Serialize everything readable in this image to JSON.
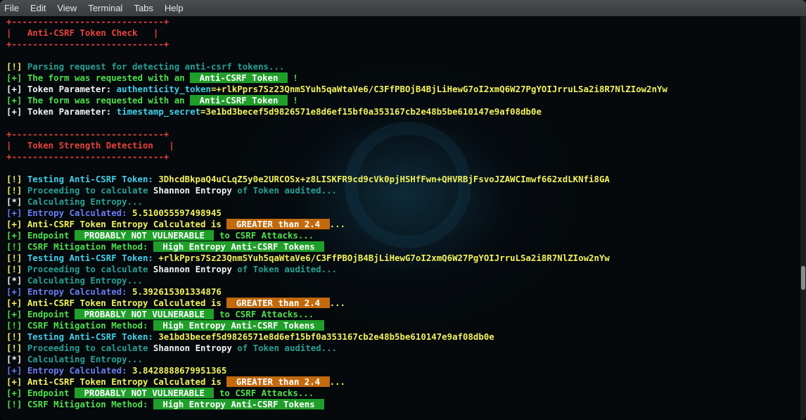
{
  "menu": [
    "File",
    "Edit",
    "View",
    "Terminal",
    "Tabs",
    "Help"
  ],
  "terminal": {
    "lines": [
      [
        {
          "t": "+-----------------------------+",
          "c": "c-red"
        }
      ],
      [
        {
          "t": "|   Anti-CSRF Token Check   |",
          "c": "c-red"
        }
      ],
      [
        {
          "t": "+-----------------------------+",
          "c": "c-red"
        }
      ],
      [],
      [
        {
          "t": "[!] ",
          "c": "c-yellow"
        },
        {
          "t": "Parsing request for detecting anti-csrf tokens...",
          "c": "c-dteal"
        }
      ],
      [
        {
          "t": "[+] ",
          "c": "c-green"
        },
        {
          "t": "The form was requested with an ",
          "c": "c-green"
        },
        {
          "t": " Anti-CSRF Token ",
          "c": "badge-green"
        },
        {
          "t": " !",
          "c": "c-green"
        }
      ],
      [
        {
          "t": "[+] ",
          "c": "c-white"
        },
        {
          "t": "Token Parameter: ",
          "c": "c-white"
        },
        {
          "t": "authenticity_token",
          "c": "c-cyan"
        },
        {
          "t": "=+rlkPprs7Sz23QnmSYuh5qaWtaVe6/C3FfPBOjB4BjLiHewG7oI2xmQ6W27PgYOIJrruLSa2i8R7NlZIow2nYw",
          "c": "c-yellow"
        }
      ],
      [
        {
          "t": "[+] ",
          "c": "c-green"
        },
        {
          "t": "The form was requested with an ",
          "c": "c-green"
        },
        {
          "t": " Anti-CSRF Token ",
          "c": "badge-green"
        },
        {
          "t": " !",
          "c": "c-green"
        }
      ],
      [
        {
          "t": "[+] ",
          "c": "c-white"
        },
        {
          "t": "Token Parameter: ",
          "c": "c-white"
        },
        {
          "t": "timestamp_secret",
          "c": "c-cyan"
        },
        {
          "t": "=3e1bd3becef5d9826571e8d6ef15bf0a353167cb2e48b5be610147e9af08db0e",
          "c": "c-yellow"
        }
      ],
      [],
      [
        {
          "t": "+-----------------------------+",
          "c": "c-red"
        }
      ],
      [
        {
          "t": "|   Token Strength Detection   |",
          "c": "c-red"
        }
      ],
      [
        {
          "t": "+-----------------------------+",
          "c": "c-red"
        }
      ],
      [],
      [
        {
          "t": "[!] ",
          "c": "c-yellow"
        },
        {
          "t": "Testing Anti-CSRF Token: ",
          "c": "c-cyan"
        },
        {
          "t": "3DhcdBkpaQ4uCLqZ5y0e2URCOSx+z8LISKFR9cd9cVk0pjHSHfFwn+QHVRBjFsvoJZAWCImwf662xdLKNfi8GA",
          "c": "c-yellow"
        }
      ],
      [
        {
          "t": "[!] ",
          "c": "c-yellow"
        },
        {
          "t": "Proceeding to calculate ",
          "c": "c-dteal"
        },
        {
          "t": "Shannon Entropy",
          "c": "c-white"
        },
        {
          "t": " of Token audited...",
          "c": "c-dteal"
        }
      ],
      [
        {
          "t": "[*] ",
          "c": "c-white"
        },
        {
          "t": "Calculating Entropy...",
          "c": "c-dteal"
        }
      ],
      [
        {
          "t": "[+] ",
          "c": "c-blue"
        },
        {
          "t": "Entropy Calculated: ",
          "c": "c-blue"
        },
        {
          "t": "5.510055597498945",
          "c": "c-yellow"
        }
      ],
      [
        {
          "t": "[+] ",
          "c": "c-yellow"
        },
        {
          "t": "Anti-CSRF Token Entropy Calculated is ",
          "c": "c-yellow"
        },
        {
          "t": " GREATER than 2.4 ",
          "c": "badge-orange"
        },
        {
          "t": "...",
          "c": "c-yellow"
        }
      ],
      [
        {
          "t": "[+] ",
          "c": "c-green"
        },
        {
          "t": "Endpoint ",
          "c": "c-green"
        },
        {
          "t": " PROBABLY NOT VULNERABLE ",
          "c": "badge-green"
        },
        {
          "t": " to CSRF Attacks...",
          "c": "c-green"
        }
      ],
      [
        {
          "t": "[!] ",
          "c": "c-green"
        },
        {
          "t": "CSRF Mitigation Method: ",
          "c": "c-green"
        },
        {
          "t": " High Entropy Anti-CSRF Tokens ",
          "c": "badge-green"
        }
      ],
      [
        {
          "t": "[!] ",
          "c": "c-yellow"
        },
        {
          "t": "Testing Anti-CSRF Token: ",
          "c": "c-cyan"
        },
        {
          "t": "+rlkPprs7Sz23QnmSYuh5qaWtaVe6/C3FfPBOjB4BjLiHewG7oI2xmQ6W27PgYOIJrruLSa2i8R7NlZIow2nYw",
          "c": "c-yellow"
        }
      ],
      [
        {
          "t": "[!] ",
          "c": "c-yellow"
        },
        {
          "t": "Proceeding to calculate ",
          "c": "c-dteal"
        },
        {
          "t": "Shannon Entropy",
          "c": "c-white"
        },
        {
          "t": " of Token audited...",
          "c": "c-dteal"
        }
      ],
      [
        {
          "t": "[*] ",
          "c": "c-white"
        },
        {
          "t": "Calculating Entropy...",
          "c": "c-dteal"
        }
      ],
      [
        {
          "t": "[+] ",
          "c": "c-blue"
        },
        {
          "t": "Entropy Calculated: ",
          "c": "c-blue"
        },
        {
          "t": "5.392615301334876",
          "c": "c-yellow"
        }
      ],
      [
        {
          "t": "[+] ",
          "c": "c-yellow"
        },
        {
          "t": "Anti-CSRF Token Entropy Calculated is ",
          "c": "c-yellow"
        },
        {
          "t": " GREATER than 2.4 ",
          "c": "badge-orange"
        },
        {
          "t": "...",
          "c": "c-yellow"
        }
      ],
      [
        {
          "t": "[+] ",
          "c": "c-green"
        },
        {
          "t": "Endpoint ",
          "c": "c-green"
        },
        {
          "t": " PROBABLY NOT VULNERABLE ",
          "c": "badge-green"
        },
        {
          "t": " to CSRF Attacks...",
          "c": "c-green"
        }
      ],
      [
        {
          "t": "[!] ",
          "c": "c-green"
        },
        {
          "t": "CSRF Mitigation Method: ",
          "c": "c-green"
        },
        {
          "t": " High Entropy Anti-CSRF Tokens ",
          "c": "badge-green"
        }
      ],
      [
        {
          "t": "[!] ",
          "c": "c-yellow"
        },
        {
          "t": "Testing Anti-CSRF Token: ",
          "c": "c-cyan"
        },
        {
          "t": "3e1bd3becef5d9826571e8d6ef15bf0a353167cb2e48b5be610147e9af08db0e",
          "c": "c-yellow"
        }
      ],
      [
        {
          "t": "[!] ",
          "c": "c-yellow"
        },
        {
          "t": "Proceeding to calculate ",
          "c": "c-dteal"
        },
        {
          "t": "Shannon Entropy",
          "c": "c-white"
        },
        {
          "t": " of Token audited...",
          "c": "c-dteal"
        }
      ],
      [
        {
          "t": "[*] ",
          "c": "c-white"
        },
        {
          "t": "Calculating Entropy...",
          "c": "c-dteal"
        }
      ],
      [
        {
          "t": "[+] ",
          "c": "c-blue"
        },
        {
          "t": "Entropy Calculated: ",
          "c": "c-blue"
        },
        {
          "t": "3.8428888679951365",
          "c": "c-yellow"
        }
      ],
      [
        {
          "t": "[+] ",
          "c": "c-yellow"
        },
        {
          "t": "Anti-CSRF Token Entropy Calculated is ",
          "c": "c-yellow"
        },
        {
          "t": " GREATER than 2.4 ",
          "c": "badge-orange"
        },
        {
          "t": "...",
          "c": "c-yellow"
        }
      ],
      [
        {
          "t": "[+] ",
          "c": "c-green"
        },
        {
          "t": "Endpoint ",
          "c": "c-green"
        },
        {
          "t": " PROBABLY NOT VULNERABLE ",
          "c": "badge-green"
        },
        {
          "t": " to CSRF Attacks...",
          "c": "c-green"
        }
      ],
      [
        {
          "t": "[!] ",
          "c": "c-green"
        },
        {
          "t": "CSRF Mitigation Method: ",
          "c": "c-green"
        },
        {
          "t": " High Entropy Anti-CSRF Tokens ",
          "c": "badge-green"
        }
      ]
    ]
  },
  "colors": {
    "terminal_bg": "#05090c",
    "menubar_bg": "#3f4245",
    "accent_red": "#e8413b",
    "accent_yellow": "#f2f25a",
    "accent_green": "#4ee04a",
    "badge_green": "#1f9e2a",
    "badge_orange": "#c26a0c"
  }
}
